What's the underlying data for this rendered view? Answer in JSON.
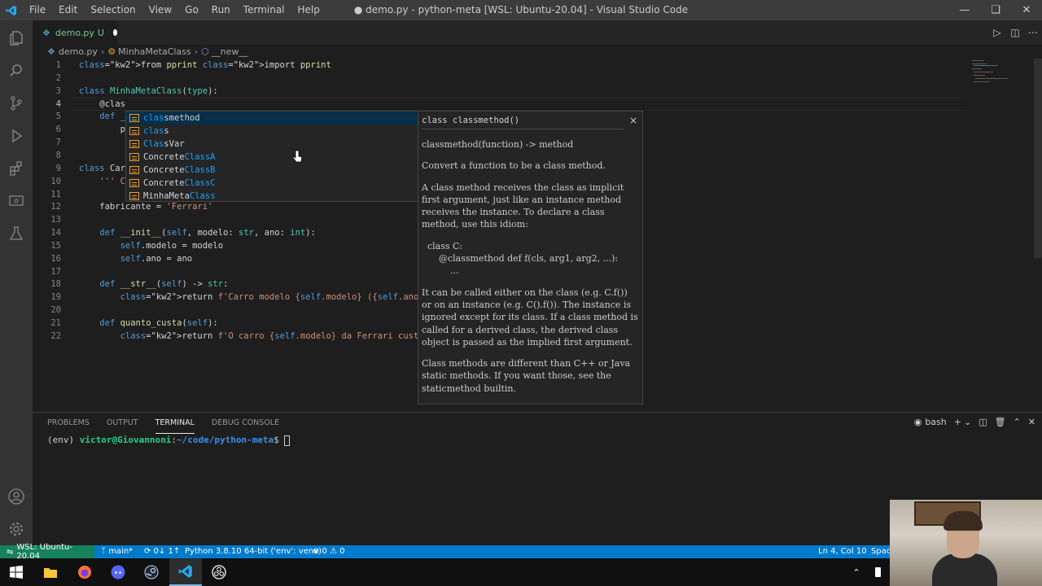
{
  "titlebar": {
    "menu": [
      "File",
      "Edit",
      "Selection",
      "View",
      "Go",
      "Run",
      "Terminal",
      "Help"
    ],
    "title": "● demo.py - python-meta [WSL: Ubuntu-20.04] - Visual Studio Code"
  },
  "tab": {
    "filename": "demo.py",
    "status": "U"
  },
  "breadcrumb": {
    "file": "demo.py",
    "class": "MinhaMetaClass",
    "method": "__new__"
  },
  "editor": {
    "lines": [
      {
        "n": "1",
        "text": "from pprint import pprint"
      },
      {
        "n": "2",
        "text": ""
      },
      {
        "n": "3",
        "text": "class MinhaMetaClass(type):"
      },
      {
        "n": "4",
        "text": "    @clas"
      },
      {
        "n": "5",
        "text": "    def _"
      },
      {
        "n": "6",
        "text": "        p"
      },
      {
        "n": "7",
        "text": ""
      },
      {
        "n": "8",
        "text": ""
      },
      {
        "n": "9",
        "text": "class Car"
      },
      {
        "n": "10",
        "text": "    ''' C"
      },
      {
        "n": "11",
        "text": ""
      },
      {
        "n": "12",
        "text": "    fabricante = 'Ferrari'"
      },
      {
        "n": "13",
        "text": ""
      },
      {
        "n": "14",
        "text": "    def __init__(self, modelo: str, ano: int):"
      },
      {
        "n": "15",
        "text": "        self.modelo = modelo"
      },
      {
        "n": "16",
        "text": "        self.ano = ano"
      },
      {
        "n": "17",
        "text": ""
      },
      {
        "n": "18",
        "text": "    def __str__(self) -> str:"
      },
      {
        "n": "19",
        "text": "        return f'Carro modelo {self.modelo} ({self.ano})'"
      },
      {
        "n": "20",
        "text": ""
      },
      {
        "n": "21",
        "text": "    def quanto_custa(self):"
      },
      {
        "n": "22",
        "text": "        return f'O carro {self.modelo} da Ferrari custa caro dema"
      }
    ]
  },
  "suggestions": [
    {
      "pre": "clas",
      "post": "smethod",
      "selected": true
    },
    {
      "pre": "clas",
      "post": "s",
      "selected": false
    },
    {
      "pre": "Clas",
      "post": "sVar",
      "selected": false
    },
    {
      "pre": "Concrete",
      "mid": "ClassA",
      "selected": false
    },
    {
      "pre": "Concrete",
      "mid": "ClassB",
      "selected": false
    },
    {
      "pre": "Concrete",
      "mid": "ClassC",
      "selected": false
    },
    {
      "pre": "MinhaMeta",
      "mid": "Class",
      "selected": false
    }
  ],
  "docs": {
    "signature": "class classmethod()",
    "close": "×",
    "p1": "classmethod(function) -> method",
    "p2": "Convert a function to be a class method.",
    "p3": "A class method receives the class as implicit first argument, just like an instance method receives the instance. To declare a class method, use this idiom:",
    "code1": "  class C:",
    "code2": "      @classmethod def f(cls, arg1, arg2, ...):",
    "code3": "          ...",
    "p4": "It can be called either on the class (e.g. C.f()) or on an instance (e.g. C().f()). The instance is ignored except for its class. If a class method is called for a derived class, the derived class object is passed as the implied first argument.",
    "p5": "Class methods are different than C++ or Java static methods. If you want those, see the staticmethod builtin."
  },
  "panel": {
    "tabs": [
      "PROBLEMS",
      "OUTPUT",
      "TERMINAL",
      "DEBUG CONSOLE"
    ],
    "active_tab": "TERMINAL",
    "shell": "bash",
    "terminal": {
      "env": "(env) ",
      "user": "victor@Giovannoni",
      "sep": ":",
      "path": "~/code/python-meta",
      "prompt": "$ "
    }
  },
  "statusbar": {
    "remote": "WSL: Ubuntu-20.04",
    "branch": "main*",
    "sync": "0↓ 1↑",
    "python": "Python 3.8.10 64-bit ('env': venv)",
    "problems": "⊗ 0 ⚠ 0",
    "position": "Ln 4, Col 10",
    "spaces": "Spac"
  },
  "icons": {
    "activity": [
      "explorer-icon",
      "search-icon",
      "source-control-icon",
      "run-debug-icon",
      "extensions-icon",
      "remote-explorer-icon",
      "testing-icon"
    ],
    "activity_bottom": [
      "account-icon",
      "settings-gear-icon"
    ]
  },
  "colors": {
    "accent": "#007acc",
    "remote": "#16825d",
    "keyword": "#569cd6",
    "class": "#4ec9b0"
  }
}
